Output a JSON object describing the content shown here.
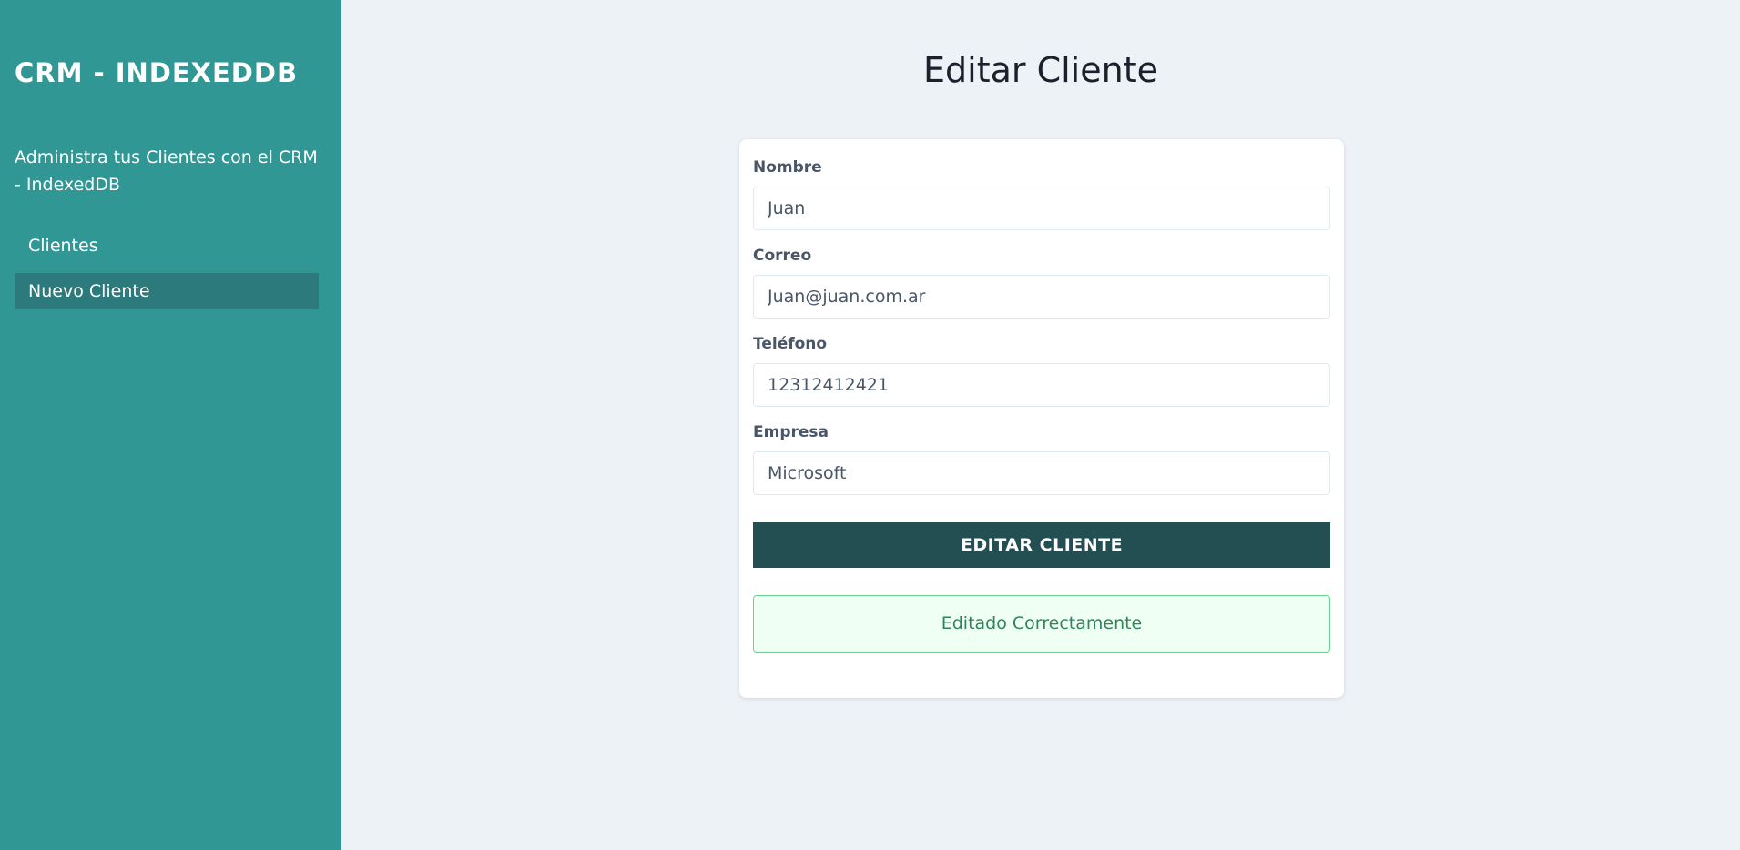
{
  "sidebar": {
    "brand": "CRM - INDEXEDDB",
    "tagline": "Administra tus Clientes con el CRM - IndexedDB",
    "nav": [
      {
        "label": "Clientes",
        "active": false
      },
      {
        "label": "Nuevo Cliente",
        "active": true
      }
    ]
  },
  "main": {
    "title": "Editar Cliente",
    "form": {
      "fields": [
        {
          "label": "Nombre",
          "value": "Juan"
        },
        {
          "label": "Correo",
          "value": "Juan@juan.com.ar"
        },
        {
          "label": "Teléfono",
          "value": "12312412421"
        },
        {
          "label": "Empresa",
          "value": "Microsoft"
        }
      ],
      "submit_label": "EDITAR CLIENTE",
      "alert": "Editado Correctamente"
    }
  },
  "colors": {
    "sidebar_bg": "#319795",
    "nav_active_bg": "#2c7a7b",
    "page_bg": "#edf2f7",
    "button_bg": "#234e52",
    "alert_bg": "#f0fff4",
    "alert_border": "#68d391",
    "alert_text": "#2f855a"
  }
}
